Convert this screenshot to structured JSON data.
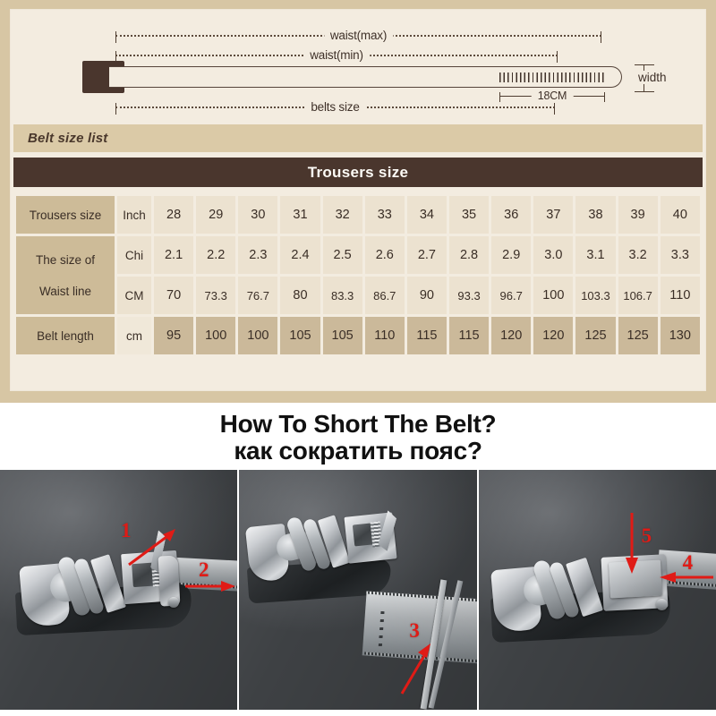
{
  "colors": {
    "panel_frame": "#d7c6a4",
    "panel_bg": "#f3ece0",
    "bar_tan": "#dbcaa7",
    "header_brown": "#4a362d",
    "cell_light": "#ece2d0",
    "cell_label": "#cdbb98",
    "cell_belt": "#cbb99a",
    "annotation_red": "#e01b16"
  },
  "diagram": {
    "waist_max_label": "waist(max)",
    "waist_min_label": "waist(min)",
    "belts_size_label": "belts size",
    "tip_length_label": "18CM",
    "width_label": "width"
  },
  "belt_size_list": {
    "title": "Belt size list"
  },
  "table": {
    "header": "Trousers size",
    "row_labels": {
      "trousers": "Trousers size",
      "waist_line_1": "The size of",
      "waist_line_2": "Waist line",
      "belt_length": "Belt length"
    },
    "units": {
      "inch": "Inch",
      "chi": "Chi",
      "cm_upper": "CM",
      "cm_lower": "cm"
    },
    "rows": [
      {
        "label": "Trousers size",
        "unit": "Inch",
        "values": [
          "28",
          "29",
          "30",
          "31",
          "32",
          "33",
          "34",
          "35",
          "36",
          "37",
          "38",
          "39",
          "40"
        ]
      },
      {
        "label": "The size of",
        "unit": "Chi",
        "values": [
          "2.1",
          "2.2",
          "2.3",
          "2.4",
          "2.5",
          "2.6",
          "2.7",
          "2.8",
          "2.9",
          "3.0",
          "3.1",
          "3.2",
          "3.3"
        ]
      },
      {
        "label": "Waist line",
        "unit": "CM",
        "values": [
          "70",
          "73.3",
          "76.7",
          "80",
          "83.3",
          "86.7",
          "90",
          "93.3",
          "96.7",
          "100",
          "103.3",
          "106.7",
          "110"
        ]
      },
      {
        "label": "Belt length",
        "unit": "cm",
        "values": [
          "95",
          "100",
          "100",
          "105",
          "105",
          "110",
          "115",
          "115",
          "120",
          "120",
          "125",
          "125",
          "130"
        ]
      }
    ]
  },
  "howto": {
    "line1": "How To Short The Belt?",
    "line2": "как сократить пояс?"
  },
  "photos": [
    {
      "annotations": [
        "1",
        "2"
      ]
    },
    {
      "annotations": [
        "3"
      ]
    },
    {
      "annotations": [
        "5",
        "4"
      ]
    }
  ],
  "chart_data": {
    "type": "table",
    "title": "Trousers size",
    "subtitle": "Belt size list",
    "columns": [
      "Trousers size",
      "Inch",
      "28",
      "29",
      "30",
      "31",
      "32",
      "33",
      "34",
      "35",
      "36",
      "37",
      "38",
      "39",
      "40"
    ],
    "rows": [
      {
        "name": "Trousers size",
        "unit": "Inch",
        "values": [
          28,
          29,
          30,
          31,
          32,
          33,
          34,
          35,
          36,
          37,
          38,
          39,
          40
        ]
      },
      {
        "name": "The size of Waist line (Chi)",
        "unit": "Chi",
        "values": [
          2.1,
          2.2,
          2.3,
          2.4,
          2.5,
          2.6,
          2.7,
          2.8,
          2.9,
          3.0,
          3.1,
          3.2,
          3.3
        ]
      },
      {
        "name": "The size of Waist line (CM)",
        "unit": "CM",
        "values": [
          70,
          73.3,
          76.7,
          80,
          83.3,
          86.7,
          90,
          93.3,
          96.7,
          100,
          103.3,
          106.7,
          110
        ]
      },
      {
        "name": "Belt length",
        "unit": "cm",
        "values": [
          95,
          100,
          100,
          105,
          105,
          110,
          115,
          115,
          120,
          120,
          125,
          125,
          130
        ]
      }
    ],
    "xlabel": "Trousers size (Inch)",
    "ylabel": "",
    "grid": true,
    "legend": "none"
  }
}
